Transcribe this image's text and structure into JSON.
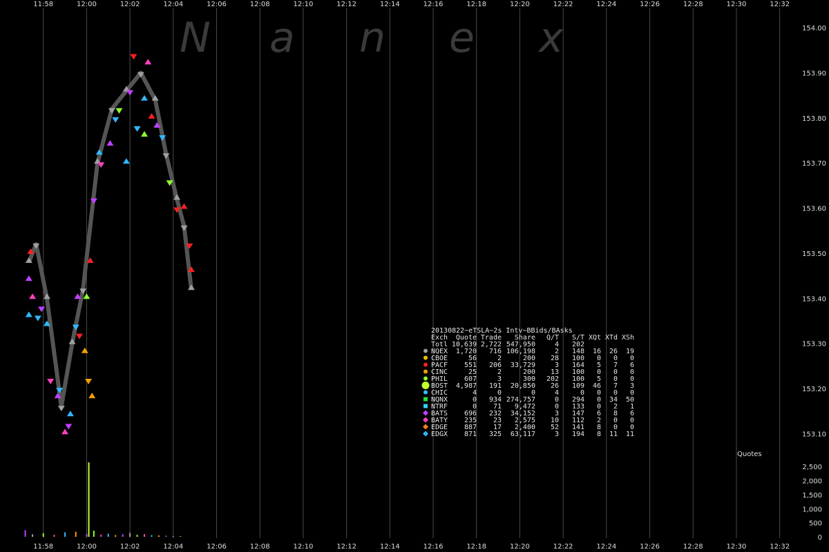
{
  "watermark": [
    "N",
    "a",
    "n",
    "e",
    "x"
  ],
  "chart_data": [
    {
      "type": "scatter",
      "title": "",
      "xlabel": "",
      "ylabel": "",
      "x_ticks": [
        "11:58",
        "12:00",
        "12:02",
        "12:04",
        "12:06",
        "12:08",
        "12:10",
        "12:12",
        "12:14",
        "12:16",
        "12:18",
        "12:20",
        "12:22",
        "12:24",
        "12:26",
        "12:28",
        "12:30",
        "12:32"
      ],
      "xlim": [
        "11:56:00",
        "12:33:00"
      ],
      "y_ticks": [
        "153.10",
        "153.20",
        "153.30",
        "153.40",
        "153.50",
        "153.60",
        "153.70",
        "153.80",
        "153.90",
        "154.00"
      ],
      "ylim": [
        153.07,
        154.04
      ],
      "grid": true,
      "series": [
        {
          "name": "NQEX",
          "color": "#a0a0a0",
          "points": [
            [
              "11:57:20",
              153.48
            ],
            [
              "11:57:40",
              153.52
            ],
            [
              "11:58:10",
              153.4
            ],
            [
              "11:58:50",
              153.16
            ],
            [
              "11:59:20",
              153.3
            ],
            [
              "11:59:50",
              153.42
            ],
            [
              "12:00:30",
              153.7
            ],
            [
              "12:01:10",
              153.82
            ],
            [
              "12:01:50",
              153.86
            ],
            [
              "12:02:30",
              153.9
            ],
            [
              "12:03:10",
              153.84
            ],
            [
              "12:03:40",
              153.72
            ],
            [
              "12:04:10",
              153.62
            ],
            [
              "12:04:30",
              153.56
            ],
            [
              "12:04:50",
              153.42
            ]
          ]
        },
        {
          "name": "PACF",
          "color": "#ff2020",
          "points": [
            [
              "11:57:25",
              153.5
            ],
            [
              "11:59:40",
              153.32
            ],
            [
              "12:00:10",
              153.48
            ],
            [
              "12:02:10",
              153.94
            ],
            [
              "12:03:00",
              153.8
            ],
            [
              "12:04:10",
              153.6
            ],
            [
              "12:04:30",
              153.6
            ],
            [
              "12:04:45",
              153.52
            ],
            [
              "12:04:50",
              153.46
            ]
          ]
        },
        {
          "name": "CINC",
          "color": "#f0a000",
          "points": [
            [
              "11:59:55",
              153.28
            ],
            [
              "12:00:05",
              153.22
            ],
            [
              "12:00:15",
              153.18
            ]
          ]
        },
        {
          "name": "PHIL",
          "color": "#90ff30",
          "points": [
            [
              "12:00:00",
              153.4
            ],
            [
              "12:01:30",
              153.82
            ],
            [
              "12:02:40",
              153.76
            ],
            [
              "12:03:50",
              153.66
            ]
          ]
        },
        {
          "name": "BATS",
          "color": "#c040ff",
          "points": [
            [
              "11:57:20",
              153.44
            ],
            [
              "11:57:55",
              153.38
            ],
            [
              "11:58:40",
              153.18
            ],
            [
              "11:59:10",
              153.12
            ],
            [
              "11:59:35",
              153.4
            ],
            [
              "12:00:20",
              153.62
            ],
            [
              "12:01:05",
              153.74
            ],
            [
              "12:02:00",
              153.86
            ],
            [
              "12:03:15",
              153.78
            ]
          ]
        },
        {
          "name": "BATY",
          "color": "#ff40c0",
          "points": [
            [
              "11:57:30",
              153.4
            ],
            [
              "11:58:20",
              153.22
            ],
            [
              "11:59:00",
              153.1
            ],
            [
              "12:00:40",
              153.7
            ],
            [
              "12:02:50",
              153.92
            ]
          ]
        },
        {
          "name": "EDGX",
          "color": "#30b8ff",
          "points": [
            [
              "11:57:20",
              153.36
            ],
            [
              "11:57:45",
              153.36
            ],
            [
              "11:58:10",
              153.34
            ],
            [
              "11:58:45",
              153.2
            ],
            [
              "11:59:15",
              153.14
            ],
            [
              "11:59:30",
              153.34
            ],
            [
              "12:00:35",
              153.72
            ],
            [
              "12:01:20",
              153.8
            ],
            [
              "12:01:50",
              153.7
            ],
            [
              "12:02:20",
              153.78
            ],
            [
              "12:02:40",
              153.84
            ],
            [
              "12:03:30",
              153.76
            ]
          ]
        }
      ]
    },
    {
      "type": "bar",
      "ylabel": "Quotes",
      "y_ticks": [
        "0",
        "500",
        "1,000",
        "1,500",
        "2,000",
        "2,500"
      ],
      "ylim": [
        0,
        2800
      ],
      "x": [
        "11:57:10",
        "11:57:30",
        "11:58:00",
        "11:58:30",
        "11:59:00",
        "11:59:30",
        "12:00:00",
        "12:00:06",
        "12:00:20",
        "12:00:40",
        "12:01:00",
        "12:01:20",
        "12:01:40",
        "12:02:00",
        "12:02:20",
        "12:02:40",
        "12:03:00",
        "12:03:20",
        "12:03:40",
        "12:04:00",
        "12:04:20"
      ],
      "values": [
        240,
        90,
        130,
        70,
        160,
        180,
        100,
        2650,
        220,
        80,
        110,
        60,
        90,
        140,
        70,
        100,
        60,
        50,
        40,
        30,
        20
      ]
    }
  ],
  "table": {
    "title": "20130822~eTSLA~2s Intv~BBids/BAsks",
    "columns": [
      "Exch",
      "Quote",
      "Trade",
      "Share",
      "Q/T",
      "S/T",
      "XQt",
      "XTd",
      "XSh"
    ],
    "total": [
      "Totl",
      "10,639",
      "2,722",
      "547,950",
      "4",
      "202",
      "",
      "",
      ""
    ],
    "rows": [
      {
        "color": "#a0a0a0",
        "shape": "circle",
        "cells": [
          "NQEX",
          "1,720",
          "716",
          "106,198",
          "2",
          "148",
          "16",
          "26",
          "19"
        ]
      },
      {
        "color": "#f0c000",
        "shape": "circle",
        "cells": [
          "CBOE",
          "56",
          "2",
          "200",
          "28",
          "100",
          "0",
          "0",
          "0"
        ]
      },
      {
        "color": "#ff2020",
        "shape": "circle",
        "cells": [
          "PACF",
          "551",
          "206",
          "33,729",
          "3",
          "164",
          "5",
          "7",
          "6"
        ]
      },
      {
        "color": "#f0a000",
        "shape": "circle",
        "cells": [
          "CINC",
          "25",
          "2",
          "200",
          "13",
          "100",
          "0",
          "0",
          "0"
        ]
      },
      {
        "color": "#90ff30",
        "shape": "circle",
        "cells": [
          "PHIL",
          "607",
          "3",
          "300",
          "202",
          "100",
          "5",
          "0",
          "0"
        ]
      },
      {
        "color": "#c0ff30",
        "shape": "big-circle",
        "cells": [
          "BOST",
          "4,987",
          "191",
          "20,850",
          "26",
          "109",
          "46",
          "7",
          "3"
        ]
      },
      {
        "color": "#30c0ff",
        "shape": "circle",
        "cells": [
          "CHIC",
          "4",
          "0",
          "0",
          "4",
          "0",
          "0",
          "0",
          "0"
        ]
      },
      {
        "color": "#20e040",
        "shape": "square",
        "cells": [
          "NQNX",
          "0",
          "934",
          "274,757",
          "0",
          "294",
          "0",
          "34",
          "50"
        ]
      },
      {
        "color": "#30d0ff",
        "shape": "square",
        "cells": [
          "NTRF",
          "0",
          "71",
          "9,472",
          "0",
          "133",
          "0",
          "2",
          "1"
        ]
      },
      {
        "color": "#c040ff",
        "shape": "diamond",
        "cells": [
          "BATS",
          "696",
          "232",
          "34,152",
          "3",
          "147",
          "6",
          "8",
          "6"
        ]
      },
      {
        "color": "#ff40c0",
        "shape": "diamond",
        "cells": [
          "BATY",
          "235",
          "23",
          "2,575",
          "10",
          "112",
          "2",
          "0",
          "0"
        ]
      },
      {
        "color": "#f08020",
        "shape": "diamond",
        "cells": [
          "EDGE",
          "887",
          "17",
          "2,400",
          "52",
          "141",
          "8",
          "0",
          "0"
        ]
      },
      {
        "color": "#30b8ff",
        "shape": "diamond",
        "cells": [
          "EDGX",
          "871",
          "325",
          "63,117",
          "3",
          "194",
          "8",
          "11",
          "11"
        ]
      }
    ]
  }
}
